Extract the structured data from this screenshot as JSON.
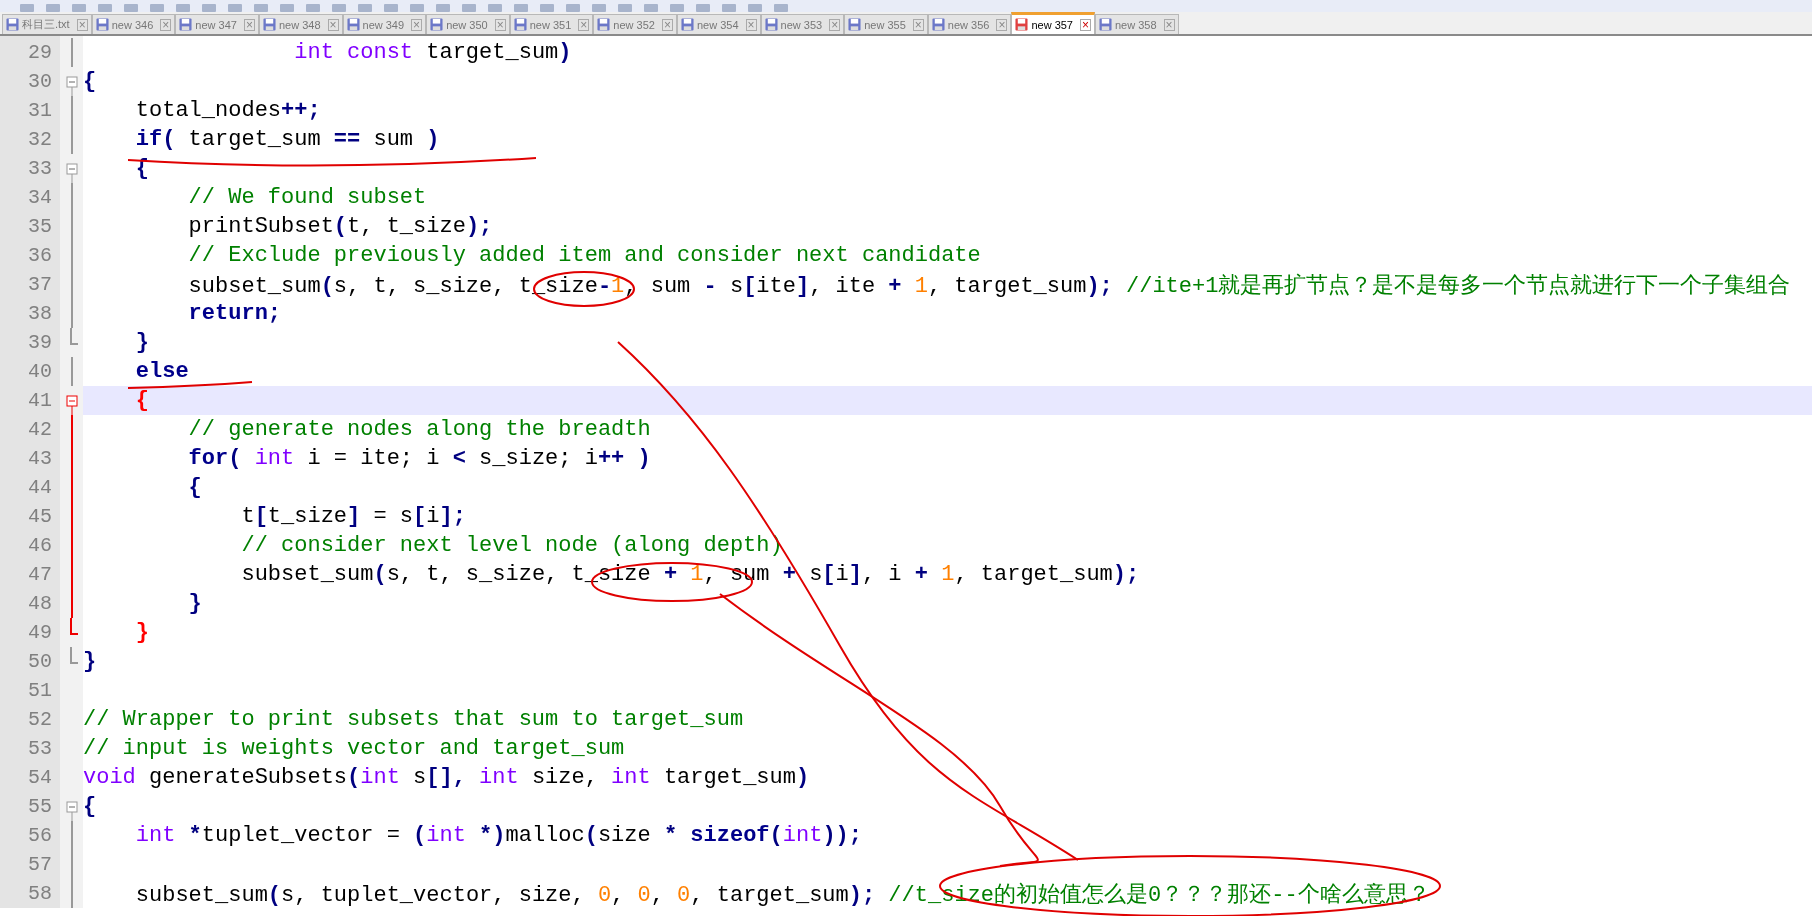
{
  "tabs": [
    {
      "label": "科目三.txt",
      "selected": false,
      "modified": false
    },
    {
      "label": "new 346",
      "selected": false,
      "modified": false
    },
    {
      "label": "new 347",
      "selected": false,
      "modified": false
    },
    {
      "label": "new 348",
      "selected": false,
      "modified": false
    },
    {
      "label": "new 349",
      "selected": false,
      "modified": false
    },
    {
      "label": "new 350",
      "selected": false,
      "modified": false
    },
    {
      "label": "new 351",
      "selected": false,
      "modified": false
    },
    {
      "label": "new 352",
      "selected": false,
      "modified": false
    },
    {
      "label": "new 354",
      "selected": false,
      "modified": false
    },
    {
      "label": "new 353",
      "selected": false,
      "modified": false
    },
    {
      "label": "new 355",
      "selected": false,
      "modified": false
    },
    {
      "label": "new 356",
      "selected": false,
      "modified": false
    },
    {
      "label": "new 357",
      "selected": true,
      "modified": true
    },
    {
      "label": "new 358",
      "selected": false,
      "modified": false
    }
  ],
  "close_glyph": "×",
  "editor": {
    "lines": [
      {
        "number": "29",
        "fold": {
          "kind": "line",
          "active": false
        },
        "current": false,
        "tokens": [
          {
            "text": "                int",
            "kind": "type"
          },
          {
            "text": " const",
            "kind": "type"
          },
          {
            "text": " target_sum",
            "kind": "id"
          },
          {
            "text": ")",
            "kind": "op"
          }
        ]
      },
      {
        "number": "30",
        "fold": {
          "kind": "open",
          "active": false
        },
        "current": false,
        "tokens": [
          {
            "text": "{",
            "kind": "op"
          }
        ]
      },
      {
        "number": "31",
        "fold": {
          "kind": "line",
          "active": false
        },
        "current": false,
        "tokens": [
          {
            "text": "    total_nodes",
            "kind": "id"
          },
          {
            "text": "++;",
            "kind": "op"
          }
        ]
      },
      {
        "number": "32",
        "fold": {
          "kind": "line",
          "active": false
        },
        "current": false,
        "tokens": [
          {
            "text": "    if",
            "kind": "kw"
          },
          {
            "text": "(",
            "kind": "op"
          },
          {
            "text": " target_sum",
            "kind": "id"
          },
          {
            "text": " ==",
            "kind": "op"
          },
          {
            "text": " sum",
            "kind": "id"
          },
          {
            "text": " )",
            "kind": "op"
          }
        ]
      },
      {
        "number": "33",
        "fold": {
          "kind": "open",
          "active": false
        },
        "current": false,
        "tokens": [
          {
            "text": "    {",
            "kind": "op"
          }
        ]
      },
      {
        "number": "34",
        "fold": {
          "kind": "line",
          "active": false
        },
        "current": false,
        "tokens": [
          {
            "text": "        // We found subset",
            "kind": "cm"
          }
        ]
      },
      {
        "number": "35",
        "fold": {
          "kind": "line",
          "active": false
        },
        "current": false,
        "tokens": [
          {
            "text": "        printSubset",
            "kind": "id"
          },
          {
            "text": "(",
            "kind": "op"
          },
          {
            "text": "t, t_size",
            "kind": "id"
          },
          {
            "text": ");",
            "kind": "op"
          }
        ]
      },
      {
        "number": "36",
        "fold": {
          "kind": "line",
          "active": false
        },
        "current": false,
        "tokens": [
          {
            "text": "        // Exclude previously added item and consider next candidate",
            "kind": "cm"
          }
        ]
      },
      {
        "number": "37",
        "fold": {
          "kind": "line",
          "active": false
        },
        "current": false,
        "tokens": [
          {
            "text": "        subset_sum",
            "kind": "id"
          },
          {
            "text": "(",
            "kind": "op"
          },
          {
            "text": "s, t, s_size, t_size",
            "kind": "id"
          },
          {
            "text": "-",
            "kind": "op"
          },
          {
            "text": "1",
            "kind": "num"
          },
          {
            "text": ", sum",
            "kind": "id"
          },
          {
            "text": " -",
            "kind": "op"
          },
          {
            "text": " s",
            "kind": "id"
          },
          {
            "text": "[",
            "kind": "op"
          },
          {
            "text": "ite",
            "kind": "id"
          },
          {
            "text": "]",
            "kind": "op"
          },
          {
            "text": ", ite",
            "kind": "id"
          },
          {
            "text": " +",
            "kind": "op"
          },
          {
            "text": " 1",
            "kind": "num"
          },
          {
            "text": ", target_sum",
            "kind": "id"
          },
          {
            "text": ");",
            "kind": "op"
          },
          {
            "text": " //ite+1就是再扩节点？是不是每多一个节点就进行下一个子集组合",
            "kind": "cm"
          }
        ]
      },
      {
        "number": "38",
        "fold": {
          "kind": "line",
          "active": false
        },
        "current": false,
        "tokens": [
          {
            "text": "        return",
            "kind": "kw"
          },
          {
            "text": ";",
            "kind": "op"
          }
        ]
      },
      {
        "number": "39",
        "fold": {
          "kind": "end",
          "active": false
        },
        "current": false,
        "tokens": [
          {
            "text": "    }",
            "kind": "op"
          }
        ]
      },
      {
        "number": "40",
        "fold": {
          "kind": "line",
          "active": false
        },
        "current": false,
        "tokens": [
          {
            "text": "    else",
            "kind": "kw"
          }
        ]
      },
      {
        "number": "41",
        "fold": {
          "kind": "open",
          "active": true
        },
        "current": true,
        "tokens": [
          {
            "text": "    {",
            "kind": "match"
          }
        ]
      },
      {
        "number": "42",
        "fold": {
          "kind": "line",
          "active": true
        },
        "current": false,
        "tokens": [
          {
            "text": "        // generate nodes along the breadth",
            "kind": "cm"
          }
        ]
      },
      {
        "number": "43",
        "fold": {
          "kind": "line",
          "active": true
        },
        "current": false,
        "tokens": [
          {
            "text": "        for",
            "kind": "kw"
          },
          {
            "text": "(",
            "kind": "op"
          },
          {
            "text": " int",
            "kind": "type"
          },
          {
            "text": " i = ite; i",
            "kind": "id"
          },
          {
            "text": " <",
            "kind": "op"
          },
          {
            "text": " s_size; i",
            "kind": "id"
          },
          {
            "text": "++ )",
            "kind": "op"
          }
        ]
      },
      {
        "number": "44",
        "fold": {
          "kind": "line",
          "active": true
        },
        "current": false,
        "tokens": [
          {
            "text": "        {",
            "kind": "op"
          }
        ]
      },
      {
        "number": "45",
        "fold": {
          "kind": "line",
          "active": true
        },
        "current": false,
        "tokens": [
          {
            "text": "            t",
            "kind": "id"
          },
          {
            "text": "[",
            "kind": "op"
          },
          {
            "text": "t_size",
            "kind": "id"
          },
          {
            "text": "]",
            "kind": "op"
          },
          {
            "text": " = s",
            "kind": "id"
          },
          {
            "text": "[",
            "kind": "op"
          },
          {
            "text": "i",
            "kind": "id"
          },
          {
            "text": "];",
            "kind": "op"
          }
        ]
      },
      {
        "number": "46",
        "fold": {
          "kind": "line",
          "active": true
        },
        "current": false,
        "tokens": [
          {
            "text": "            // consider next level node (along depth)",
            "kind": "cm"
          }
        ]
      },
      {
        "number": "47",
        "fold": {
          "kind": "line",
          "active": true
        },
        "current": false,
        "tokens": [
          {
            "text": "            subset_sum",
            "kind": "id"
          },
          {
            "text": "(",
            "kind": "op"
          },
          {
            "text": "s, t, s_size, t_size",
            "kind": "id"
          },
          {
            "text": " +",
            "kind": "op"
          },
          {
            "text": " 1",
            "kind": "num"
          },
          {
            "text": ", sum",
            "kind": "id"
          },
          {
            "text": " +",
            "kind": "op"
          },
          {
            "text": " s",
            "kind": "id"
          },
          {
            "text": "[",
            "kind": "op"
          },
          {
            "text": "i",
            "kind": "id"
          },
          {
            "text": "]",
            "kind": "op"
          },
          {
            "text": ", i",
            "kind": "id"
          },
          {
            "text": " +",
            "kind": "op"
          },
          {
            "text": " 1",
            "kind": "num"
          },
          {
            "text": ", target_sum",
            "kind": "id"
          },
          {
            "text": ");",
            "kind": "op"
          }
        ]
      },
      {
        "number": "48",
        "fold": {
          "kind": "line",
          "active": true
        },
        "current": false,
        "tokens": [
          {
            "text": "        }",
            "kind": "op"
          }
        ]
      },
      {
        "number": "49",
        "fold": {
          "kind": "end",
          "active": true
        },
        "current": false,
        "tokens": [
          {
            "text": "    }",
            "kind": "match"
          }
        ]
      },
      {
        "number": "50",
        "fold": {
          "kind": "end",
          "active": false
        },
        "current": false,
        "tokens": [
          {
            "text": "}",
            "kind": "op"
          }
        ]
      },
      {
        "number": "51",
        "current": false
      },
      {
        "number": "52",
        "current": false,
        "tokens": [
          {
            "text": "// Wrapper to print subsets that sum to target_sum",
            "kind": "cm"
          }
        ]
      },
      {
        "number": "53",
        "current": false,
        "tokens": [
          {
            "text": "// input is weights vector and target_sum",
            "kind": "cm"
          }
        ]
      },
      {
        "number": "54",
        "current": false,
        "tokens": [
          {
            "text": "void",
            "kind": "type"
          },
          {
            "text": " generateSubsets",
            "kind": "id"
          },
          {
            "text": "(",
            "kind": "op"
          },
          {
            "text": "int",
            "kind": "type"
          },
          {
            "text": " s",
            "kind": "id"
          },
          {
            "text": "[],",
            "kind": "op"
          },
          {
            "text": " int",
            "kind": "type"
          },
          {
            "text": " size,",
            "kind": "id"
          },
          {
            "text": " int",
            "kind": "type"
          },
          {
            "text": " target_sum",
            "kind": "id"
          },
          {
            "text": ")",
            "kind": "op"
          }
        ]
      },
      {
        "number": "55",
        "fold": {
          "kind": "open",
          "active": false
        },
        "current": false,
        "tokens": [
          {
            "text": "{",
            "kind": "op"
          }
        ]
      },
      {
        "number": "56",
        "fold": {
          "kind": "line",
          "active": false
        },
        "current": false,
        "tokens": [
          {
            "text": "    int",
            "kind": "type"
          },
          {
            "text": " *",
            "kind": "op"
          },
          {
            "text": "tuplet_vector =",
            "kind": "id"
          },
          {
            "text": " (",
            "kind": "op"
          },
          {
            "text": "int",
            "kind": "type"
          },
          {
            "text": " *)",
            "kind": "op"
          },
          {
            "text": "malloc",
            "kind": "id"
          },
          {
            "text": "(",
            "kind": "op"
          },
          {
            "text": "size",
            "kind": "id"
          },
          {
            "text": " *",
            "kind": "op"
          },
          {
            "text": " sizeof",
            "kind": "kw"
          },
          {
            "text": "(",
            "kind": "op"
          },
          {
            "text": "int",
            "kind": "type"
          },
          {
            "text": "));",
            "kind": "op"
          }
        ]
      },
      {
        "number": "57",
        "fold": {
          "kind": "line",
          "active": false
        },
        "current": false
      },
      {
        "number": "58",
        "fold": {
          "kind": "line",
          "active": false
        },
        "current": false,
        "tokens": [
          {
            "text": "    subset_sum",
            "kind": "id"
          },
          {
            "text": "(",
            "kind": "op"
          },
          {
            "text": "s, tuplet_vector, size,",
            "kind": "id"
          },
          {
            "text": " 0",
            "kind": "num"
          },
          {
            "text": ",",
            "kind": "id"
          },
          {
            "text": " 0",
            "kind": "num"
          },
          {
            "text": ",",
            "kind": "id"
          },
          {
            "text": " 0",
            "kind": "num"
          },
          {
            "text": ", target_sum",
            "kind": "id"
          },
          {
            "text": ");",
            "kind": "op"
          },
          {
            "text": " //t_size的初始值怎么是0？？？那还--个啥么意思？",
            "kind": "cm"
          }
        ]
      }
    ]
  }
}
